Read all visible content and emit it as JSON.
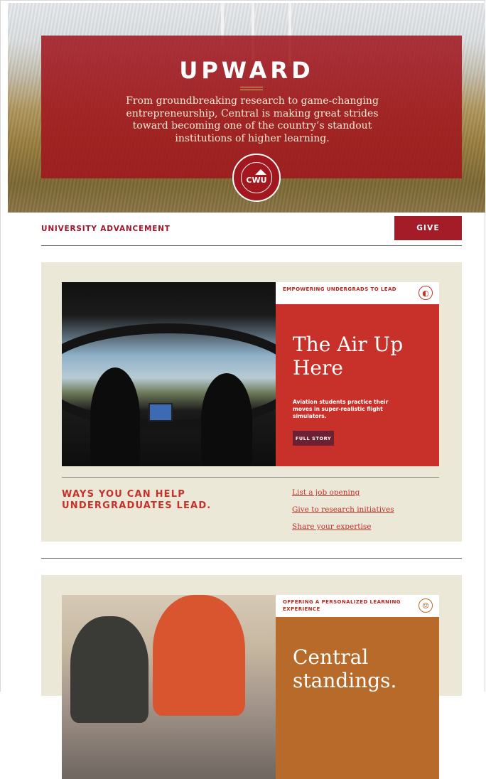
{
  "hero": {
    "title": "UPWARD",
    "subtitle": "From groundbreaking research to game-changing entrepreneurship, Central is making great strides toward becoming one of the country’s standout institutions of higher learning.",
    "seal_text": "CWU"
  },
  "nav": {
    "label": "UNIVERSITY ADVANCEMENT",
    "give_label": "GIVE"
  },
  "card1": {
    "section_label": "EMPOWERING UNDERGRADS TO LEAD",
    "icon": "globe-icon",
    "title": "The Air Up Here",
    "description": "Aviation students practice their moves in super-realistic flight simulators.",
    "cta": "FULL STORY",
    "ways_heading": "WAYS YOU CAN HELP UNDERGRADUATES LEAD.",
    "links": [
      "List a job opening",
      "Give to research initiatives",
      "Share your expertise"
    ]
  },
  "card2": {
    "section_label": "OFFERING A PERSONALIZED LEARNING EXPERIENCE",
    "icon": "people-icon",
    "title": "Central standings."
  },
  "colors": {
    "brand_red": "#a31c28",
    "feature_red": "#c8302a",
    "feature_orange": "#b86a2a",
    "card_bg": "#ece8d8"
  }
}
